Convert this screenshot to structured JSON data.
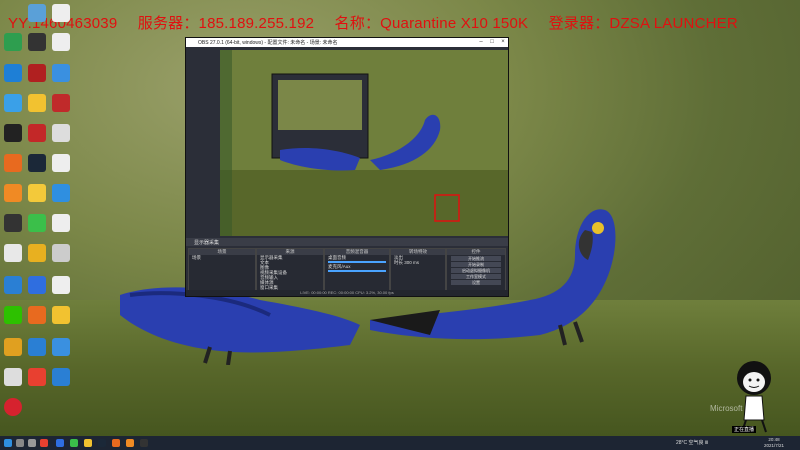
{
  "overlay": {
    "qq": "YY:1460463039",
    "server": "服务器：185.189.255.192",
    "name": "名称：Quarantine X10 150K",
    "launcher": "登录器：DZSA LAUNCHER"
  },
  "obs": {
    "title": "OBS 27.0.1 (64-bit, windows) - 配置文件: 未命名 - 场景: 未命名",
    "toolbar_label": "显示器采集",
    "docks": {
      "scenes": {
        "title": "场景",
        "items": [
          "场景"
        ]
      },
      "sources": {
        "title": "来源",
        "items": [
          "显示器采集",
          "文本",
          "图像",
          "视频采集设备",
          "音频输入",
          "媒体源",
          "窗口采集",
          "浏览器"
        ]
      },
      "mixer": {
        "title": "音频混音器",
        "items": [
          "桌面音频",
          "麦克风/Aux"
        ]
      },
      "transitions": {
        "title": "转场特效",
        "items": [
          "淡出",
          "时长 300 ms"
        ]
      },
      "controls": {
        "title": "控件",
        "items": [
          "开始推流",
          "开始录制",
          "启动虚拟摄像机",
          "工作室模式",
          "设置",
          "退出"
        ]
      }
    },
    "status": "LIVE: 00:00:00   REC: 00:00:00   CPU: 3.2%, 30.00 fps"
  },
  "desktop": {
    "watermark": "Microsoft"
  },
  "taskbar": {
    "tray": "28°C 空气良 Ⅲ",
    "time": "20:48",
    "date": "2021/7/21"
  },
  "mascot_caption": "正在直播",
  "colors": {
    "overlay_text": "#e01010",
    "parrot": "#2a3fb0",
    "beak": "#e8c12a",
    "grass": "#58672a",
    "taskbar": "#1d2533"
  }
}
